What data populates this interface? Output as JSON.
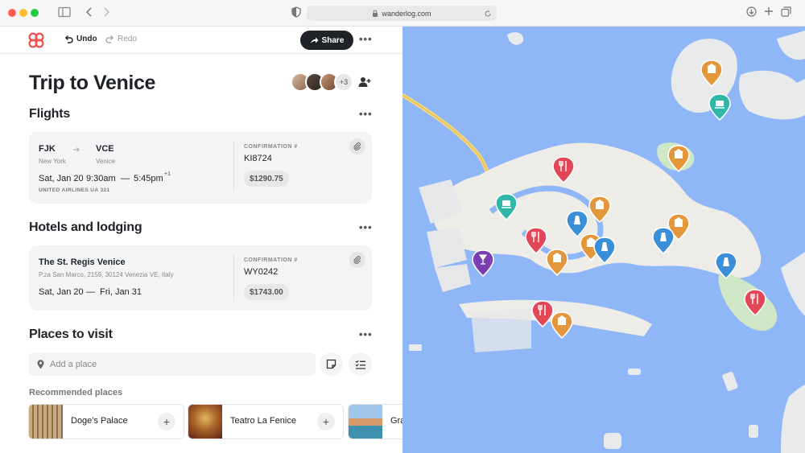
{
  "browser": {
    "url": "wanderlog.com",
    "controls": [
      "close",
      "minimize",
      "zoom"
    ]
  },
  "toolbar": {
    "undo_label": "Undo",
    "redo_label": "Redo",
    "share_label": "Share"
  },
  "trip": {
    "title": "Trip to Venice",
    "extra_travelers": "+3"
  },
  "flights": {
    "heading": "Flights",
    "from_code": "FJK",
    "from_city": "New York",
    "to_code": "VCE",
    "to_city": "Venice",
    "date": "Sat, Jan 20",
    "depart": "9:30am",
    "dash": "—",
    "arrive": "5:45pm",
    "arrive_offset": "+1",
    "airline": "UNITED AIRLINES UA 321",
    "confirmation_label": "CONFIRMATION #",
    "confirmation": "KI8724",
    "price": "$1290.75"
  },
  "hotels": {
    "heading": "Hotels and lodging",
    "name": "The St. Regis Venice",
    "address": "P.za San Marco, 2159, 30124 Venezia VE, Italy",
    "check_in": "Sat, Jan 20",
    "dash": "—",
    "check_out": "Fri, Jan 31",
    "confirmation_label": "CONFIRMATION #",
    "confirmation": "WY0242",
    "price": "$1743.00"
  },
  "places": {
    "heading": "Places to visit",
    "add_placeholder": "Add a place",
    "recommended_label": "Recommended places",
    "recommended": [
      {
        "name": "Doge's Palace"
      },
      {
        "name": "Teatro La Fenice"
      },
      {
        "name": "Gra"
      }
    ]
  },
  "map": {
    "pins": [
      {
        "kind": "museum",
        "color": "#e3973a"
      },
      {
        "kind": "ferry",
        "color": "#2fb7a9"
      },
      {
        "kind": "museum",
        "color": "#e3973a"
      },
      {
        "kind": "restaurant",
        "color": "#e24757"
      },
      {
        "kind": "ferry",
        "color": "#2fb7a9"
      },
      {
        "kind": "museum",
        "color": "#e3973a"
      },
      {
        "kind": "landmark",
        "color": "#3b8fd8"
      },
      {
        "kind": "museum",
        "color": "#e3973a"
      },
      {
        "kind": "landmark",
        "color": "#3b8fd8"
      },
      {
        "kind": "restaurant",
        "color": "#e24757"
      },
      {
        "kind": "museum",
        "color": "#e3973a"
      },
      {
        "kind": "landmark",
        "color": "#3b8fd8"
      },
      {
        "kind": "museum",
        "color": "#e3973a"
      },
      {
        "kind": "bar",
        "color": "#7a3fb0"
      },
      {
        "kind": "landmark",
        "color": "#3b8fd8"
      },
      {
        "kind": "restaurant",
        "color": "#e24757"
      },
      {
        "kind": "restaurant",
        "color": "#e24757"
      },
      {
        "kind": "museum",
        "color": "#e3973a"
      }
    ]
  }
}
